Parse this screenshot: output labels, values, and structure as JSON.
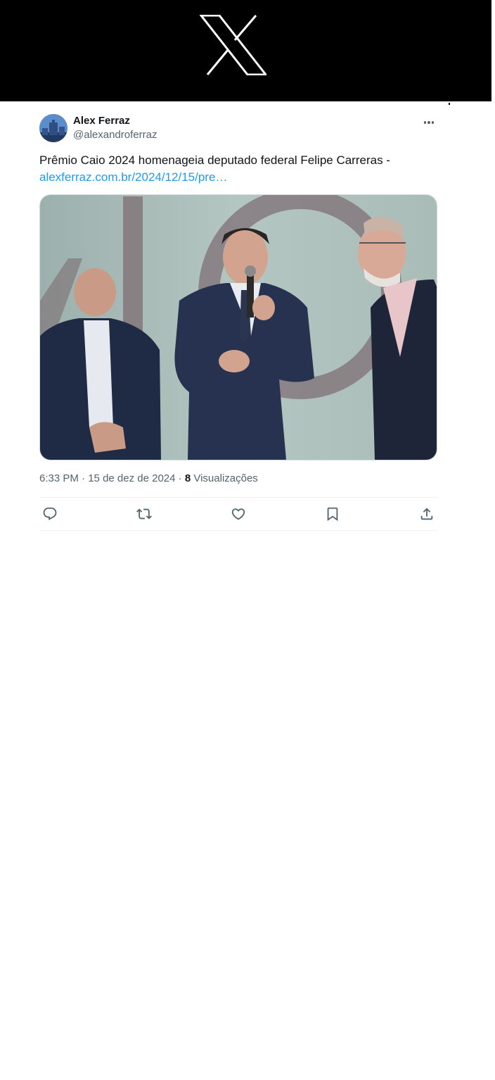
{
  "brand": {
    "logo": "x-logo-icon",
    "background": "#000000"
  },
  "tweet": {
    "author": {
      "name": "Alex Ferraz",
      "handle": "@alexandroferraz"
    },
    "text": "Prêmio Caio 2024 homenageia deputado federal Felipe Carreras -",
    "link": "alexferraz.com.br/2024/12/15/pre…",
    "time": "6:33 PM",
    "separator1": "·",
    "date": "15 de dez de 2024",
    "separator2": "·",
    "views_count": "8",
    "views_label": "Visualizações",
    "actions": [
      "reply-icon",
      "retweet-icon",
      "like-icon",
      "bookmark-icon",
      "share-icon"
    ]
  },
  "colors": {
    "text": "#0f1419",
    "secondary": "#536471",
    "link": "#1d9bf0",
    "border": "#cfd9de"
  }
}
